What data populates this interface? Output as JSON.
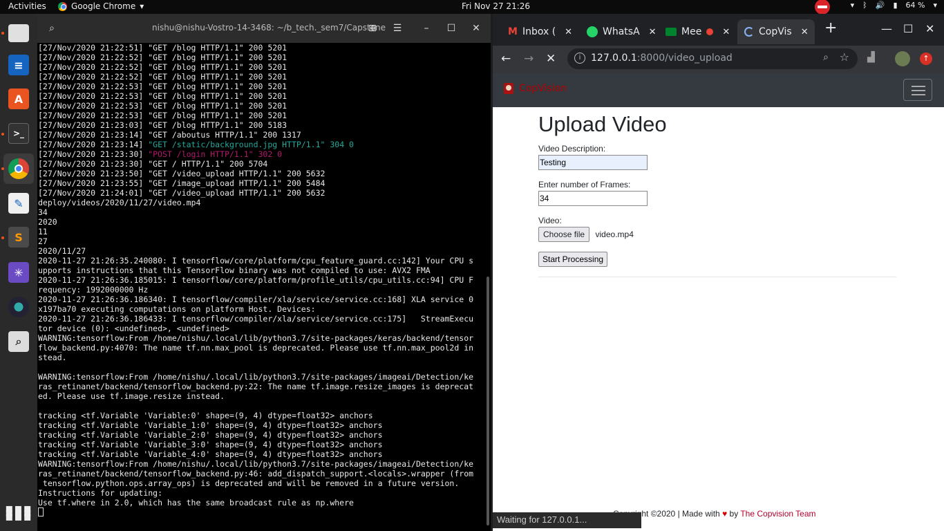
{
  "topbar": {
    "activities": "Activities",
    "app_name": "Google Chrome",
    "clock": "Fri Nov 27  21:26",
    "battery": "64 %"
  },
  "dock": {
    "items": [
      "files-icon",
      "writer-icon",
      "software-icon",
      "terminal-icon",
      "chrome-icon",
      "text-editor-icon",
      "sublime-icon",
      "network-icon",
      "camera-icon",
      "search-app-icon"
    ]
  },
  "terminal": {
    "title": "nishu@nishu-Vostro-14-3468: ~/b_tech._sem7/Capstone",
    "lines": [
      {
        "t": "[27/Nov/2020 21:22:51] \"GET /blog HTTP/1.1\" 200 5201"
      },
      {
        "t": "[27/Nov/2020 21:22:52] \"GET /blog HTTP/1.1\" 200 5201"
      },
      {
        "t": "[27/Nov/2020 21:22:52] \"GET /blog HTTP/1.1\" 200 5201"
      },
      {
        "t": "[27/Nov/2020 21:22:52] \"GET /blog HTTP/1.1\" 200 5201"
      },
      {
        "t": "[27/Nov/2020 21:22:53] \"GET /blog HTTP/1.1\" 200 5201"
      },
      {
        "t": "[27/Nov/2020 21:22:53] \"GET /blog HTTP/1.1\" 200 5201"
      },
      {
        "t": "[27/Nov/2020 21:22:53] \"GET /blog HTTP/1.1\" 200 5201"
      },
      {
        "t": "[27/Nov/2020 21:22:53] \"GET /blog HTTP/1.1\" 200 5201"
      },
      {
        "t": "[27/Nov/2020 21:23:03] \"GET /blog HTTP/1.1\" 200 5183"
      },
      {
        "t": "[27/Nov/2020 21:23:14] \"GET /aboutus HTTP/1.1\" 200 1317"
      },
      {
        "p": "[27/Nov/2020 21:23:14] ",
        "c": "\"GET /static/background.jpg HTTP/1.1\" 304 0",
        "k": "teal"
      },
      {
        "p": "[27/Nov/2020 21:23:30] ",
        "c": "\"POST /login HTTP/1.1\" 302 0",
        "k": "pink"
      },
      {
        "t": "[27/Nov/2020 21:23:30] \"GET / HTTP/1.1\" 200 5704"
      },
      {
        "t": "[27/Nov/2020 21:23:50] \"GET /video_upload HTTP/1.1\" 200 5632"
      },
      {
        "t": "[27/Nov/2020 21:23:55] \"GET /image_upload HTTP/1.1\" 200 5484"
      },
      {
        "t": "[27/Nov/2020 21:24:01] \"GET /video_upload HTTP/1.1\" 200 5632"
      },
      {
        "t": "deploy/videos/2020/11/27/video.mp4"
      },
      {
        "t": "34"
      },
      {
        "t": "2020"
      },
      {
        "t": "11"
      },
      {
        "t": "27"
      },
      {
        "t": "2020/11/27"
      },
      {
        "t": "2020-11-27 21:26:35.240080: I tensorflow/core/platform/cpu_feature_guard.cc:142] Your CPU s"
      },
      {
        "t": "upports instructions that this TensorFlow binary was not compiled to use: AVX2 FMA"
      },
      {
        "t": "2020-11-27 21:26:36.185015: I tensorflow/core/platform/profile_utils/cpu_utils.cc:94] CPU F"
      },
      {
        "t": "requency: 1992000000 Hz"
      },
      {
        "t": "2020-11-27 21:26:36.186340: I tensorflow/compiler/xla/service/service.cc:168] XLA service 0"
      },
      {
        "t": "x197ba70 executing computations on platform Host. Devices:"
      },
      {
        "t": "2020-11-27 21:26:36.186433: I tensorflow/compiler/xla/service/service.cc:175]   StreamExecu"
      },
      {
        "t": "tor device (0): <undefined>, <undefined>"
      },
      {
        "t": "WARNING:tensorflow:From /home/nishu/.local/lib/python3.7/site-packages/keras/backend/tensor"
      },
      {
        "t": "flow_backend.py:4070: The name tf.nn.max_pool is deprecated. Please use tf.nn.max_pool2d in"
      },
      {
        "t": "stead."
      },
      {
        "t": ""
      },
      {
        "t": "WARNING:tensorflow:From /home/nishu/.local/lib/python3.7/site-packages/imageai/Detection/ke"
      },
      {
        "t": "ras_retinanet/backend/tensorflow_backend.py:22: The name tf.image.resize_images is deprecat"
      },
      {
        "t": "ed. Please use tf.image.resize instead."
      },
      {
        "t": ""
      },
      {
        "t": "tracking <tf.Variable 'Variable:0' shape=(9, 4) dtype=float32> anchors"
      },
      {
        "t": "tracking <tf.Variable 'Variable_1:0' shape=(9, 4) dtype=float32> anchors"
      },
      {
        "t": "tracking <tf.Variable 'Variable_2:0' shape=(9, 4) dtype=float32> anchors"
      },
      {
        "t": "tracking <tf.Variable 'Variable_3:0' shape=(9, 4) dtype=float32> anchors"
      },
      {
        "t": "tracking <tf.Variable 'Variable_4:0' shape=(9, 4) dtype=float32> anchors"
      },
      {
        "t": "WARNING:tensorflow:From /home/nishu/.local/lib/python3.7/site-packages/imageai/Detection/ke"
      },
      {
        "t": "ras_retinanet/backend/tensorflow_backend.py:46: add_dispatch_support.<locals>.wrapper (from"
      },
      {
        "t": " tensorflow.python.ops.array_ops) is deprecated and will be removed in a future version."
      },
      {
        "t": "Instructions for updating:"
      },
      {
        "t": "Use tf.where in 2.0, which has the same broadcast rule as np.where"
      }
    ]
  },
  "browser": {
    "tabs": [
      {
        "label": "Inbox (",
        "icon": "gmail-icon"
      },
      {
        "label": "WhatsA",
        "icon": "whatsapp-icon"
      },
      {
        "label": "Mee",
        "icon": "meet-icon"
      },
      {
        "label": "CopVis",
        "icon": "loading-icon"
      }
    ],
    "url_host": "127.0.0.1",
    "url_rest": ":8000/video_upload",
    "status": "Waiting for 127.0.0.1..."
  },
  "page": {
    "brand": "CopVision",
    "heading": "Upload Video",
    "desc_label": "Video Description:",
    "desc_value": "Testing",
    "frames_label": "Enter number of Frames:",
    "frames_value": "34",
    "video_label": "Video:",
    "choose_file": "Choose file",
    "file_name": "video.mp4",
    "submit": "Start Processing",
    "footer_text": "Copyright ©2020 | Made with",
    "footer_by": "by",
    "footer_team": "The Copvision Team"
  },
  "colors": {
    "accent_red": "#b2002e",
    "terminal_teal": "#23a99a",
    "terminal_pink": "#b2196b"
  }
}
